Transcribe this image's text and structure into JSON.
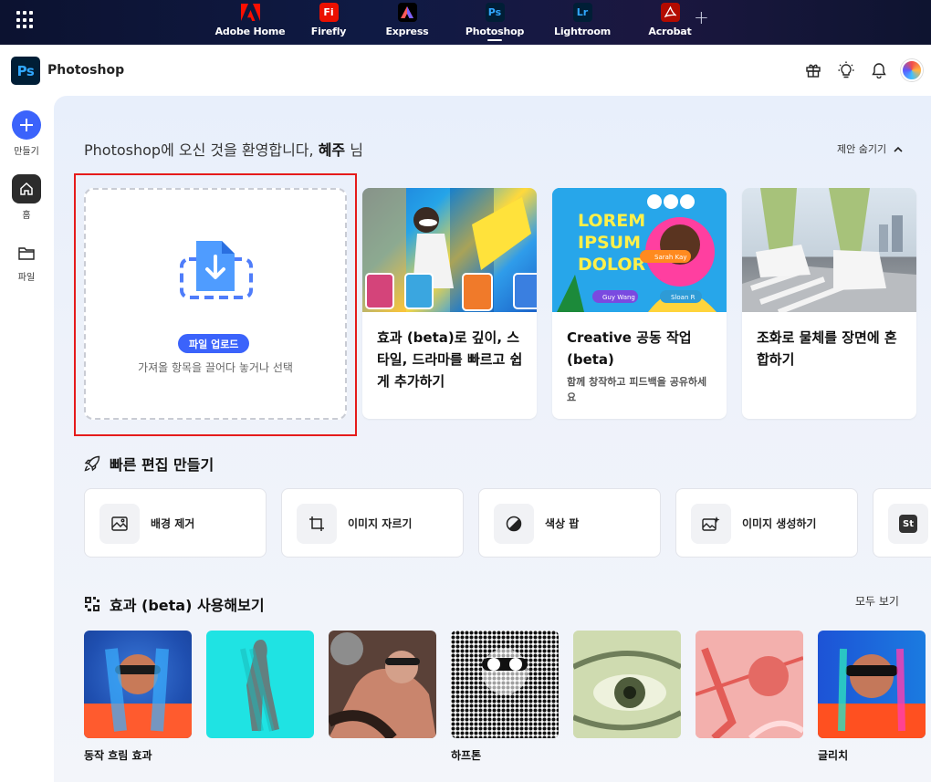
{
  "topbar": {
    "apps": [
      {
        "label": "Adobe Home",
        "icon_text": "",
        "bg": "transparent",
        "fg": "#fa0f00"
      },
      {
        "label": "Firefly",
        "icon_text": "Fi",
        "bg": "#eb1000",
        "fg": "#ffffff"
      },
      {
        "label": "Express",
        "icon_text": "A",
        "bg": "#000000",
        "fg": "#ff6a3d"
      },
      {
        "label": "Photoshop",
        "icon_text": "Ps",
        "bg": "#001e36",
        "fg": "#31a8ff"
      },
      {
        "label": "Lightroom",
        "icon_text": "Lr",
        "bg": "#001e36",
        "fg": "#31a8ff"
      },
      {
        "label": "Acrobat",
        "icon_text": "",
        "bg": "#b30b00",
        "fg": "#ffffff"
      }
    ],
    "active_app": "Photoshop"
  },
  "header": {
    "logo_text": "Ps",
    "title": "Photoshop"
  },
  "rail": {
    "create_label": "만들기",
    "home_label": "홈",
    "files_label": "파일"
  },
  "main": {
    "welcome_prefix": "Photoshop에 오신 것을 환영합니다, ",
    "welcome_name": "혜주",
    "welcome_suffix": " 님",
    "hide_suggestions": "제안 숨기기",
    "upload": {
      "button": "파일 업로드",
      "hint": "가져올 항목을 끌어다 놓거나 선택"
    },
    "promos": [
      {
        "title": "효과 (beta)로 깊이, 스타일, 드라마를 빠르고 쉽게 추가하기",
        "subtitle": ""
      },
      {
        "title": "Creative 공동 작업 (beta)",
        "subtitle": "함께 창작하고 피드백을 공유하세요"
      },
      {
        "title": "조화로 물체를 장면에 혼합하기",
        "subtitle": ""
      }
    ],
    "promo2_art": {
      "line1": "LOREM",
      "line2": "IPSUM",
      "line3": "DOLOR",
      "tag1": "Sarah Kay",
      "tag2": "Guy Wang",
      "tag3": "Sloan R"
    },
    "quick_title": "빠른 편집 만들기",
    "quick_actions": [
      {
        "label": "배경 제거"
      },
      {
        "label": "이미지 자르기"
      },
      {
        "label": "색상 팝"
      },
      {
        "label": "이미지 생성하기"
      },
      {
        "label": ""
      }
    ],
    "quick_partial_icon_text": "St",
    "effects_title": "효과 (beta) 사용해보기",
    "see_all": "모두 보기",
    "effects": [
      {
        "label": "동작 흐림 효과"
      },
      {
        "label": ""
      },
      {
        "label": ""
      },
      {
        "label": "하프톤"
      },
      {
        "label": ""
      },
      {
        "label": ""
      },
      {
        "label": "글리치"
      }
    ]
  },
  "colors": {
    "accent": "#3b63fb",
    "highlight_outline": "#e51b1b"
  }
}
